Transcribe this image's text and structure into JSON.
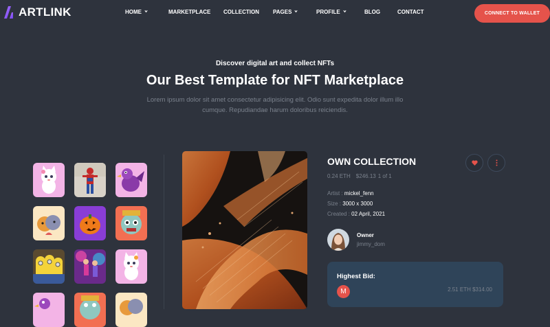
{
  "brand": {
    "name": "ARTLINK"
  },
  "nav": {
    "items": [
      {
        "label": "HOME",
        "has_dropdown": true
      },
      {
        "label": "MARKETPLACE",
        "has_dropdown": false
      },
      {
        "label": "COLLECTION",
        "has_dropdown": false
      },
      {
        "label": "PAGES",
        "has_dropdown": true
      },
      {
        "label": "PROFILE",
        "has_dropdown": true
      },
      {
        "label": "BLOG",
        "has_dropdown": false
      },
      {
        "label": "CONTACT",
        "has_dropdown": false
      }
    ],
    "cta_label": "CONNECT TO WALLET"
  },
  "hero": {
    "subtitle": "Discover digital art and collect NFTs",
    "title": "Our Best Template for NFT Marketplace",
    "description": "Lorem ipsum dolor sit amet consectetur adipisicing elit. Odio sunt expedita dolor illum illo cumque. Repudiandae harum doloribus reiciendis."
  },
  "item": {
    "title": "OWN COLLECTION",
    "price_eth": "0.24 ETH",
    "price_usd": "$246.13",
    "edition": "1 of 1",
    "artist_label": "Artist :",
    "artist": "mickel_fenn",
    "size_label": "Size :",
    "size": "3000 x 3000",
    "created_label": "Created :",
    "created": "02 April, 2021",
    "owner_label": "Owner",
    "owner": "jimmy_dom",
    "highest_bid_label": "Highest Bid:",
    "bidder_initial": "M",
    "highest_bid": "2.51 ETH $314.00"
  },
  "colors": {
    "background": "#2e333d",
    "accent": "#e5534b",
    "muted_text": "#7b828d",
    "bid_card": "#2f4459"
  }
}
